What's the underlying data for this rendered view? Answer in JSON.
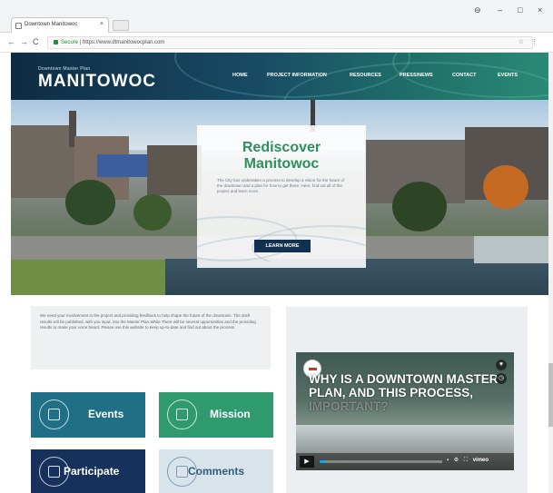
{
  "browser": {
    "tab_title": "Downtown Manitowoc",
    "tab_close": "×",
    "url_secure": "Secure",
    "url": "https://www.dtmanitowocplan.com",
    "nav_back": "←",
    "nav_forward": "→",
    "nav_reload": "C",
    "win_minimize": "–",
    "win_restore": "□",
    "win_close": "×",
    "profile": "⊖",
    "omni_icons": "☆ ⋮"
  },
  "site": {
    "logo_sub": "Downtown Master Plan",
    "logo_main": "MANITOWOC",
    "menu": [
      "HOME",
      "PROJECT INFORMATION",
      "RESOURCES",
      "PRESS/NEWS",
      "CONTACT",
      "EVENTS"
    ],
    "hero": {
      "title_line1": "Rediscover",
      "title_line2": "Manitowoc",
      "body": "The City has undertaken a process to develop a vision for the future of the downtown and a plan for how to get there. Here, find out all of the project and learn more.",
      "button": "LEARN MORE"
    },
    "intro_text": "We need your involvement in the project and providing feedback to help shape the future of the downtown. The draft results will be published, with you input, into the Master Plan.While There will be several opportunities and the providing results to make your voice heard. Please use this website to keep up-to-date and find out about the process.",
    "tiles": {
      "events": "Events",
      "mission": "Mission",
      "participate": "Participate",
      "comments": "Comments"
    },
    "video": {
      "title_a": "WHY IS A DOWNTOWN MASTER PLAN, AND THIS PROCESS, ",
      "title_b": "IMPORTANT?",
      "play": "▶",
      "controls": "▪ ⚙ ⛶",
      "vimeo": "vimeo",
      "heart": "♥",
      "clock": "◷"
    }
  },
  "colors": {
    "header_dark": "#0e2c43",
    "accent_green": "#2d8f5e",
    "events_tile": "#1f6f86",
    "mission_tile": "#2f9a6e",
    "participate_tile": "#16325c",
    "comments_tile": "#d9e3ea",
    "button_navy": "#12304f"
  }
}
